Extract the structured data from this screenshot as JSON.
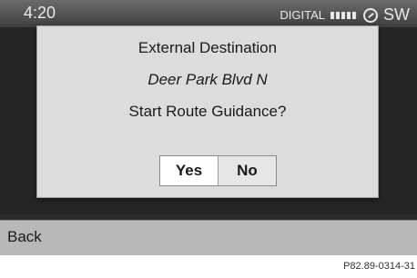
{
  "status_bar": {
    "time": "4:20",
    "radio_label": "DIGITAL",
    "heading": "SW"
  },
  "dialog": {
    "title": "External Destination",
    "destination": "Deer Park Blvd N",
    "question": "Start Route Guidance?",
    "yes_label": "Yes",
    "no_label": "No",
    "selected": "Yes"
  },
  "footer": {
    "back_label": "Back"
  },
  "image_ref": "P82.89-0314-31"
}
